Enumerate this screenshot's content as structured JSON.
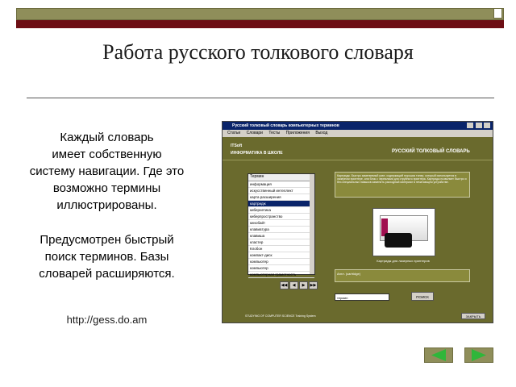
{
  "title": "Работа русского толкового словаря",
  "paragraph1": [
    "Каждый словарь",
    "имеет собственную",
    "систему навигации. Где это",
    "возможно термины",
    "иллюстрированы."
  ],
  "paragraph2": [
    "Предусмотрен быстрый",
    "поиск терминов. Базы",
    "словарей расширяются."
  ],
  "link": "http://gess.do.am",
  "app": {
    "window_title": "Русский толковый словарь компьютерных терминов",
    "menu": [
      "Статьи",
      "Словари",
      "Тесты",
      "Приложения",
      "Выход"
    ],
    "header_left": "ITSoft",
    "header_left_sub": "ИНФОРМАТИКА В ШКОЛЕ",
    "header_right": "РУССКИЙ ТОЛКОВЫЙ СЛОВАРЬ",
    "list_header": "Термин",
    "terms": [
      "информация",
      "искусственный интеллект",
      "карта расширения",
      "картридж",
      "кибернетика",
      "киберпространство",
      "кинобайт",
      "клавиатура",
      "клавиша",
      "кластер",
      "Клобон",
      "компакт-диск",
      "компьютер",
      "компьютер",
      "компьютерная грамотность"
    ],
    "selected_index": 3,
    "description": "Картридж. Быстро заменяемый узел, содержащий порошок тонер, который используется в лазерном принтере, или блок с чернилами для струйного принтера. Картридж позволяет быстро и без специальных навыков заменить расходный материал в печатающем устройстве.",
    "image_caption": "Картридж для лазерных принтеров",
    "term_bar": "Англ. (cartridge)",
    "search_placeholder": "термин",
    "search_button": "ПОИСК",
    "footer_text": "STUDYING OF COMPUTER SCIENCE Training System",
    "close_button": "ЗАКРЫТЬ",
    "nav": [
      "◀◀",
      "◀",
      "▶",
      "▶▶"
    ]
  },
  "colors": {
    "olive": "#8f8e5a",
    "dark_red": "#6d0e14",
    "arrow_green": "#2fb63a"
  }
}
